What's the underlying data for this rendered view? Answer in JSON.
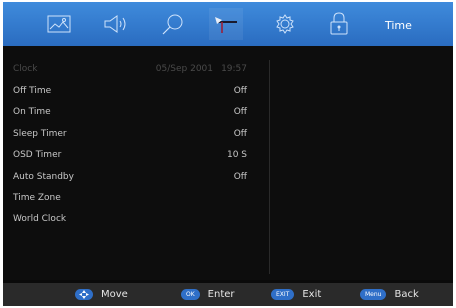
{
  "menu": {
    "title": "Time",
    "tabs": [
      {
        "icon": "picture-icon"
      },
      {
        "icon": "sound-icon"
      },
      {
        "icon": "search-icon"
      },
      {
        "icon": "clock-icon"
      },
      {
        "icon": "gear-icon"
      },
      {
        "icon": "lock-icon"
      }
    ],
    "active_tab": "clock-icon",
    "accent_color": "#2f6fc8"
  },
  "settings": [
    {
      "label": "Clock",
      "date": "05/Sep 2001",
      "time": "19:57",
      "disabled": true
    },
    {
      "label": "Off Time",
      "value": "Off"
    },
    {
      "label": "On Time",
      "value": "Off"
    },
    {
      "label": "Sleep Timer",
      "value": "Off"
    },
    {
      "label": "OSD Timer",
      "value": "10 S"
    },
    {
      "label": "Auto Standby",
      "value": "Off"
    },
    {
      "label": "Time Zone",
      "value": ""
    },
    {
      "label": "World Clock",
      "value": ""
    }
  ],
  "footer": {
    "move": {
      "key_icon": "dpad-icon",
      "label": "Move"
    },
    "enter": {
      "key": "OK",
      "label": "Enter"
    },
    "exit": {
      "key": "EXIT",
      "label": "Exit"
    },
    "back": {
      "key": "Menu",
      "label": "Back"
    }
  }
}
